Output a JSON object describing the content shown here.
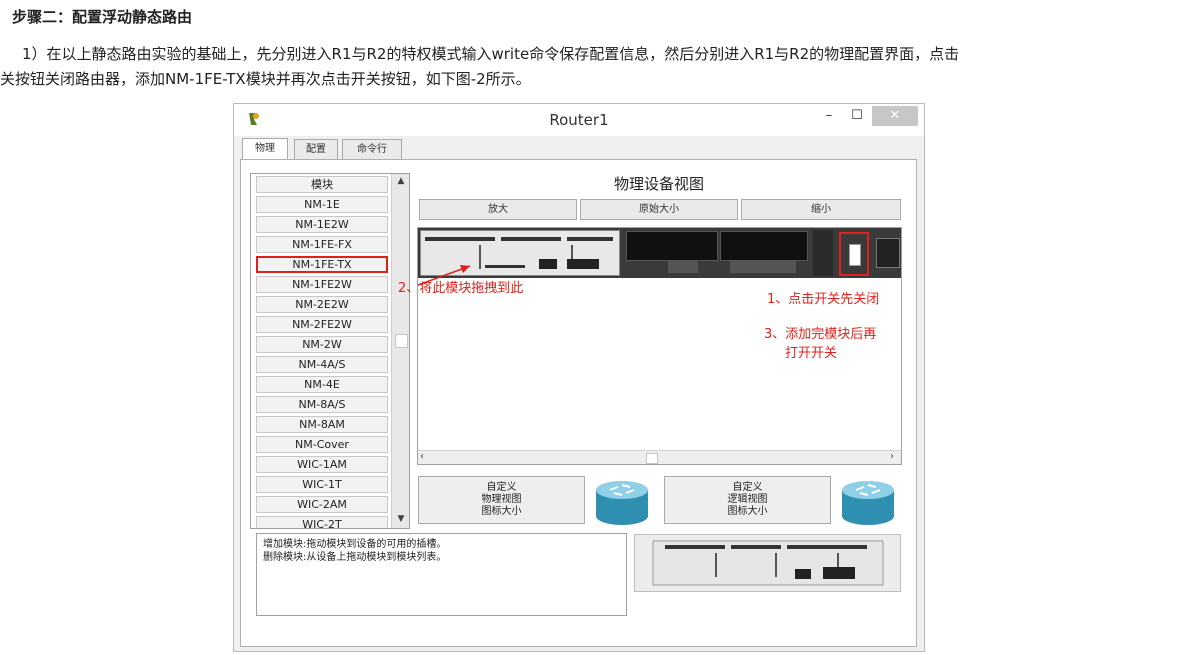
{
  "heading": "步骤二：配置浮动静态路由",
  "paragraph": {
    "line1": "1）在以上静态路由实验的基础上，先分别进入R1与R2的特权模式输入write命令保存配置信息，然后分别进入R1与R2的物理配置界面，点击",
    "line2": "关按钮关闭路由器，添加NM-1FE-TX模块并再次点击开关按钮，如下图-2所示。"
  },
  "window": {
    "title": "Router1",
    "minimize": "–",
    "maximize": "☐",
    "close": "✕",
    "tabs": [
      "物理",
      "配置",
      "命令行"
    ]
  },
  "modules": {
    "header": "模块",
    "items": [
      "NM-1E",
      "NM-1E2W",
      "NM-1FE-FX",
      "NM-1FE-TX",
      "NM-1FE2W",
      "NM-2E2W",
      "NM-2FE2W",
      "NM-2W",
      "NM-4A/S",
      "NM-4E",
      "NM-8A/S",
      "NM-8AM",
      "NM-Cover",
      "WIC-1AM",
      "WIC-1T",
      "WIC-2AM",
      "WIC-2T"
    ],
    "selected": "NM-1FE-TX"
  },
  "physical_view": {
    "title": "物理设备视图",
    "zoom_in": "放大",
    "original_size": "原始大小",
    "zoom_out": "缩小"
  },
  "annotations": {
    "drag": "2、将此模块拖拽到此",
    "power_off": "1、点击开关先关闭",
    "after_add_1": "3、添加完模块后再",
    "after_add_2": "打开开关"
  },
  "custom_buttons": {
    "physical": [
      "自定义",
      "物理视图",
      "图标大小"
    ],
    "logical": [
      "自定义",
      "逻辑视图",
      "图标大小"
    ]
  },
  "help": {
    "line1": "增加模块:拖动模块到设备的可用的插槽。",
    "line2": "删除模块:从设备上拖动模块到模块列表。"
  },
  "colors": {
    "annotation_red": "#e0201a",
    "chassis": "#3a3a3a"
  },
  "icons": [
    "app-icon",
    "router-icon",
    "scroll-up-icon",
    "scroll-down-icon",
    "arrow-icon"
  ]
}
